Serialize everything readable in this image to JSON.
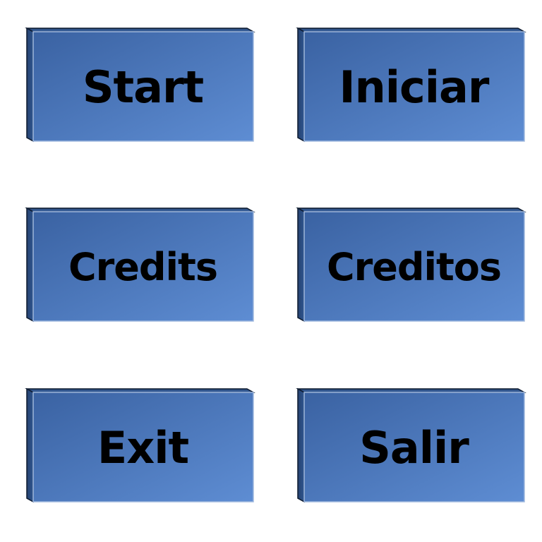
{
  "buttons": {
    "start_label": "Start",
    "iniciar_label": "Iniciar",
    "credits_label": "Credits",
    "creditos_label": "Creditos",
    "exit_label": "Exit",
    "salir_label": "Salir"
  },
  "colors": {
    "face_gradient_start": "#3b65a6",
    "face_gradient_end": "#5b8ad0",
    "side_dark": "#2b4c7f",
    "top_light": "#3f6aa8",
    "outline": "#0d1a2e",
    "text": "#000000"
  }
}
